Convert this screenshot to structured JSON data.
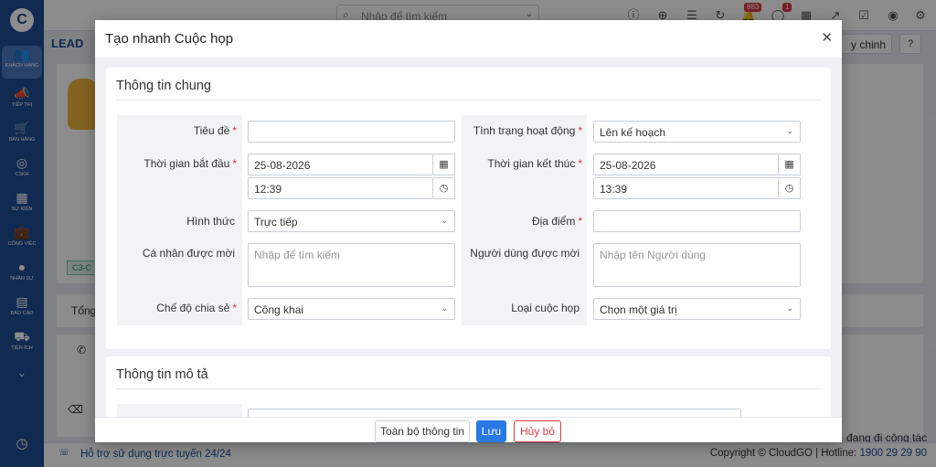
{
  "app": {
    "logo_letter": "C",
    "sidebar": [
      {
        "label": "KHÁCH HÀNG",
        "icon": "users-icon",
        "glyph": "👥"
      },
      {
        "label": "TIẾP THỊ",
        "icon": "megaphone-icon",
        "glyph": "📣"
      },
      {
        "label": "BÁN HÀNG",
        "icon": "cart-icon",
        "glyph": "🛒"
      },
      {
        "label": "CSKH",
        "icon": "support-icon",
        "glyph": "◎"
      },
      {
        "label": "SỰ KIỆN",
        "icon": "calendar-icon",
        "glyph": "▦"
      },
      {
        "label": "CÔNG VIỆC",
        "icon": "briefcase-icon",
        "glyph": "💼"
      },
      {
        "label": "NHÂN SỰ",
        "icon": "person-icon",
        "glyph": "●"
      },
      {
        "label": "BÁO CÁO",
        "icon": "report-icon",
        "glyph": "▤"
      },
      {
        "label": "TIỆN ÍCH",
        "icon": "puzzle-icon",
        "glyph": "⛟"
      }
    ]
  },
  "topbar": {
    "search_placeholder": "Nhập để tìm kiếm",
    "notification_count": "883",
    "chat_count": "1"
  },
  "background": {
    "breadcrumb": "LEAD",
    "select_text": "y chinh",
    "tag": "C3-C",
    "tab_total": "Tổng",
    "status_text": "đang đi công tác"
  },
  "footer": {
    "support": "Hỗ trợ sử dụng trực tuyến 24/24",
    "copyright": "Copyright © CloudGO | Hotline: ",
    "hotline": "1900 29 29 90"
  },
  "modal": {
    "title": "Tạo nhanh Cuộc họp",
    "section_general": "Thông tin chung",
    "section_description": "Thông tin mô tả",
    "fields": {
      "subject": {
        "label": "Tiêu đề",
        "value": ""
      },
      "status": {
        "label": "Tình trạng hoạt động",
        "value": "Lên kế hoạch"
      },
      "start_time": {
        "label": "Thời gian bắt đầu",
        "date": "25-08-2026",
        "time": "12:39"
      },
      "end_time": {
        "label": "Thời gian kết thúc",
        "date": "25-08-2026",
        "time": "13:39"
      },
      "type": {
        "label": "Hình thức",
        "value": "Trực tiếp"
      },
      "location": {
        "label": "Địa điểm",
        "value": ""
      },
      "invitees": {
        "label": "Cá nhân được mời",
        "placeholder": "Nhập để tìm kiếm"
      },
      "invited_users": {
        "label": "Người dùng được mời",
        "placeholder": "Nhập tên Người dùng"
      },
      "share_mode": {
        "label": "Chế độ chia sẻ",
        "value": "Công khai"
      },
      "meeting_type": {
        "label": "Loại cuộc họp",
        "value": "Chọn một giá trị"
      }
    },
    "buttons": {
      "full_info": "Toàn bộ thông tin",
      "save": "Lưu",
      "cancel": "Hủy bỏ"
    }
  }
}
